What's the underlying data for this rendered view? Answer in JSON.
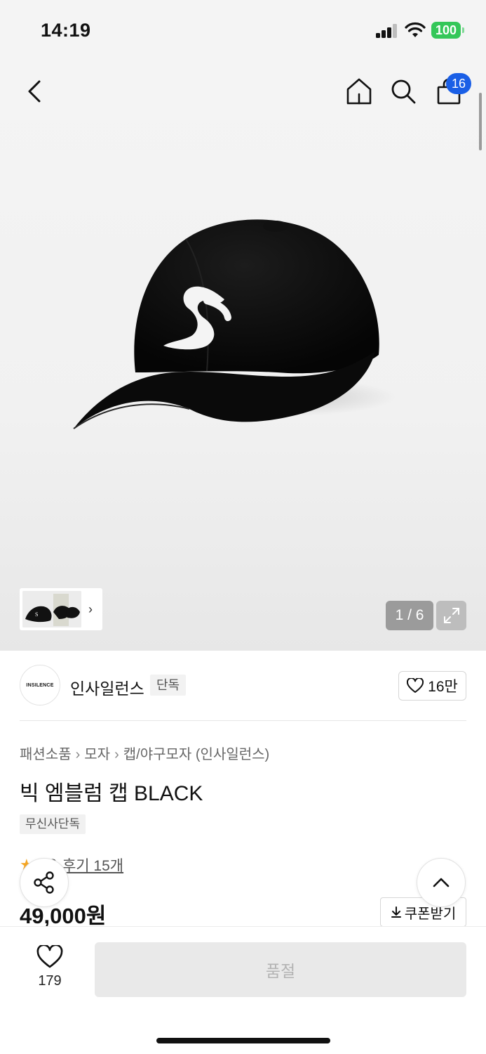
{
  "status_bar": {
    "time": "14:19",
    "battery": "100"
  },
  "nav": {
    "cart_count": "16"
  },
  "gallery": {
    "page_indicator": "1 / 6"
  },
  "brand": {
    "logo_text": "INSILENCE",
    "name": "인사일런스",
    "exclusive_tag": "단독",
    "likes": "16만"
  },
  "breadcrumb": [
    "패션소품",
    "모자",
    "캡/야구모자 (인사일런스)"
  ],
  "product": {
    "title": "빅 엠블럼 캡 BLACK",
    "store_tag": "무신사단독",
    "rating": "4.8",
    "review_link": "후기 15개",
    "price": "49,000원"
  },
  "coupon": {
    "label": "쿠폰받기"
  },
  "bottom_bar": {
    "wish_count": "179",
    "soldout_label": "품절"
  },
  "colors": {
    "accent": "#1a5fe6",
    "star": "#f5a623",
    "battery": "#34c759"
  }
}
